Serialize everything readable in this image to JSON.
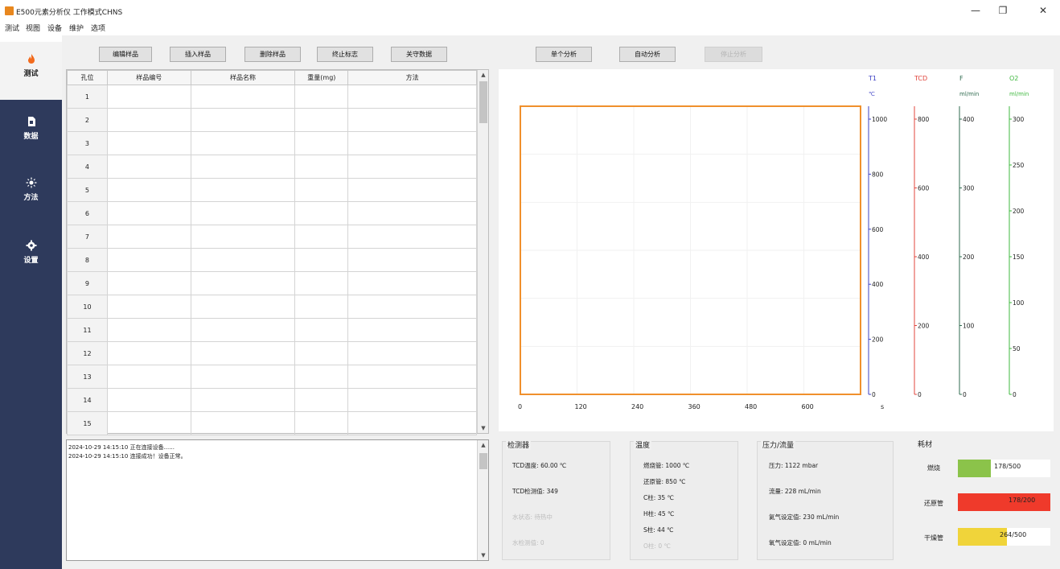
{
  "window": {
    "title": "E500元素分析仪 工作模式CHNS",
    "controls": [
      "—",
      "❐",
      "✕"
    ]
  },
  "menu": [
    "测试",
    "视图",
    "设备",
    "维护",
    "选项"
  ],
  "sidebar": [
    {
      "label": "测试",
      "icon": "flame-icon"
    },
    {
      "label": "数据",
      "icon": "document-icon"
    },
    {
      "label": "方法",
      "icon": "sun-icon"
    },
    {
      "label": "设置",
      "icon": "gear-icon"
    }
  ],
  "toolbar": {
    "edit": "编辑样品",
    "insert": "插入样品",
    "delete": "删除样品",
    "terminate": "终止标志",
    "close_data": "关守数据",
    "single": "单个分析",
    "auto": "自动分析",
    "stop": "停止分析"
  },
  "table": {
    "headers": [
      "孔位",
      "样品编号",
      "样品名称",
      "重量(mg)",
      "方法"
    ],
    "rows": [
      "1",
      "2",
      "3",
      "4",
      "5",
      "6",
      "7",
      "8",
      "9",
      "10",
      "11",
      "12",
      "13",
      "14",
      "15"
    ]
  },
  "log": [
    "2024-10-29 14:15:10  正在连接设备......",
    "2024-10-29 14:15:10  连接成功！设备正常。"
  ],
  "chart_data": {
    "type": "line",
    "x_ticks": [
      "0",
      "120",
      "240",
      "360",
      "480",
      "600"
    ],
    "x_unit": "s",
    "xlim": [
      0,
      720
    ],
    "series": [],
    "axes": [
      {
        "name": "T1",
        "unit": "℃",
        "ticks": [
          "1000",
          "800",
          "600",
          "400",
          "200",
          "0"
        ],
        "color": "#3b3fc4"
      },
      {
        "name": "TCD",
        "unit": "",
        "ticks": [
          "800",
          "600",
          "400",
          "200",
          "0"
        ],
        "color": "#e0443c"
      },
      {
        "name": "F",
        "unit": "ml/min",
        "ticks": [
          "400",
          "300",
          "200",
          "100",
          "0"
        ],
        "color": "#2f6b4f"
      },
      {
        "name": "O2",
        "unit": "ml/min",
        "ticks": [
          "300",
          "250",
          "200",
          "150",
          "100",
          "50",
          "0"
        ],
        "color": "#3fb83f"
      }
    ],
    "plot_border_color": "#f0902c"
  },
  "panels": {
    "detector": {
      "title": "检测器",
      "lines": [
        "TCD温度: 60.00 ℃",
        "TCD检测值: 349",
        "水状态: 待热中",
        "水检测值: 0"
      ]
    },
    "temperature": {
      "title": "温度",
      "lines": [
        "燃烧管: 1000 ℃",
        "还原管: 850 ℃",
        "C柱: 35 ℃",
        "H柱: 45 ℃",
        "S柱: 44 ℃",
        "O柱: 0 ℃"
      ]
    },
    "pressure": {
      "title": "压力/流量",
      "lines": [
        "压力: 1122 mbar",
        "流量: 228 mL/min",
        "氦气设定值: 230 mL/min",
        "氧气设定值: 0 mL/min"
      ]
    },
    "consumables": {
      "title": "耗材",
      "items": [
        {
          "name": "燃烧",
          "text": "178/500",
          "fraction": 0.356,
          "color": "#8bc34a"
        },
        {
          "name": "还原管",
          "text": "178/200",
          "fraction": 1.0,
          "color": "#ef3a2b"
        },
        {
          "name": "干燥管",
          "text": "264/500",
          "fraction": 0.528,
          "color": "#f0d43a"
        }
      ]
    }
  }
}
